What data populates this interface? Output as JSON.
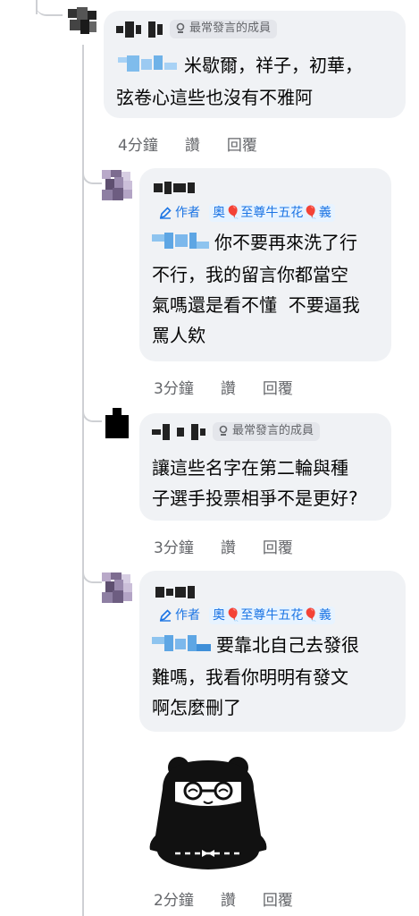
{
  "badges": {
    "top_member": "最常發言的成員",
    "author": "作者",
    "flair": "奧🎈至尊牛五花🎈義"
  },
  "comments": [
    {
      "text": "米歇爾，祥子，初華，弦卷心這些也沒有不雅阿",
      "line1": "米歇爾，祥子，初華，",
      "line2": "弦卷心這些也沒有不雅阿",
      "time": "4分鐘",
      "like": "讚",
      "reply": "回覆"
    },
    {
      "line1": "你不要再來洗了行",
      "line2": "不行，我的留言你都當空",
      "line3": "氣嗎還是看不懂  不要逼我",
      "line4": "罵人欸",
      "time": "3分鐘",
      "like": "讚",
      "reply": "回覆"
    },
    {
      "line1": "讓這些名字在第二輪與種",
      "line2": "子選手投票相爭不是更好?",
      "time": "3分鐘",
      "like": "讚",
      "reply": "回覆"
    },
    {
      "line1": "要靠北自己去發很",
      "line2": "難嗎，我看你明明有發文",
      "line3": "啊怎麼刪了",
      "time": "2分鐘",
      "like": "讚",
      "reply": "回覆"
    }
  ],
  "colors": {
    "bubble": "#f0f2f5",
    "meta": "#65676b",
    "author_blue": "#1b74e4",
    "thread_line": "#ced0d4"
  }
}
